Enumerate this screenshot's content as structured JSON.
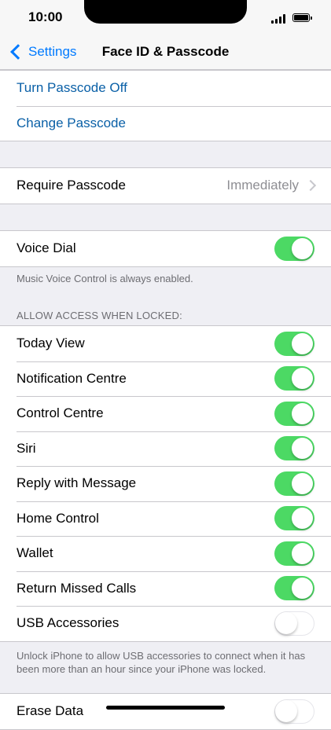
{
  "status": {
    "time": "10:00"
  },
  "nav": {
    "back_label": "Settings",
    "title": "Face ID & Passcode"
  },
  "passcode_actions": [
    "Turn Passcode Off",
    "Change Passcode"
  ],
  "require_passcode": {
    "label": "Require Passcode",
    "value": "Immediately"
  },
  "voice_dial": {
    "label": "Voice Dial",
    "on": true,
    "footer": "Music Voice Control is always enabled."
  },
  "locked_access": {
    "header": "ALLOW ACCESS WHEN LOCKED:",
    "items": [
      {
        "label": "Today View",
        "on": true
      },
      {
        "label": "Notification Centre",
        "on": true
      },
      {
        "label": "Control Centre",
        "on": true
      },
      {
        "label": "Siri",
        "on": true
      },
      {
        "label": "Reply with Message",
        "on": true
      },
      {
        "label": "Home Control",
        "on": true
      },
      {
        "label": "Wallet",
        "on": true
      },
      {
        "label": "Return Missed Calls",
        "on": true
      },
      {
        "label": "USB Accessories",
        "on": false
      }
    ],
    "footer": "Unlock iPhone to allow USB accessories to connect when it has been more than an hour since your iPhone was locked."
  },
  "erase_data": {
    "label": "Erase Data",
    "on": false
  },
  "colors": {
    "toggle_on": "#4cd964",
    "link": "#0a60a7",
    "back": "#007aff"
  }
}
